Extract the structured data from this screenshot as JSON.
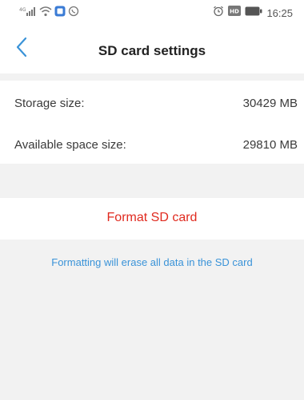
{
  "status_bar": {
    "time": "16:25",
    "icons_left": [
      "signal-icon",
      "wifi-icon",
      "app-notification-icon",
      "whatsapp-icon"
    ],
    "icons_right": [
      "alarm-icon",
      "hd-icon",
      "battery-icon"
    ]
  },
  "nav": {
    "title": "SD card settings",
    "back_icon": "chevron-left-icon"
  },
  "storage": {
    "storage_size_label": "Storage size:",
    "storage_size_value": "30429 MB",
    "available_label": "Available space size:",
    "available_value": "29810 MB"
  },
  "actions": {
    "format_label": "Format SD card"
  },
  "notice": {
    "warning": "Formatting will erase all data in the SD card"
  },
  "colors": {
    "accent": "#3a93d8",
    "danger": "#e02a1f",
    "background": "#f2f2f2"
  }
}
